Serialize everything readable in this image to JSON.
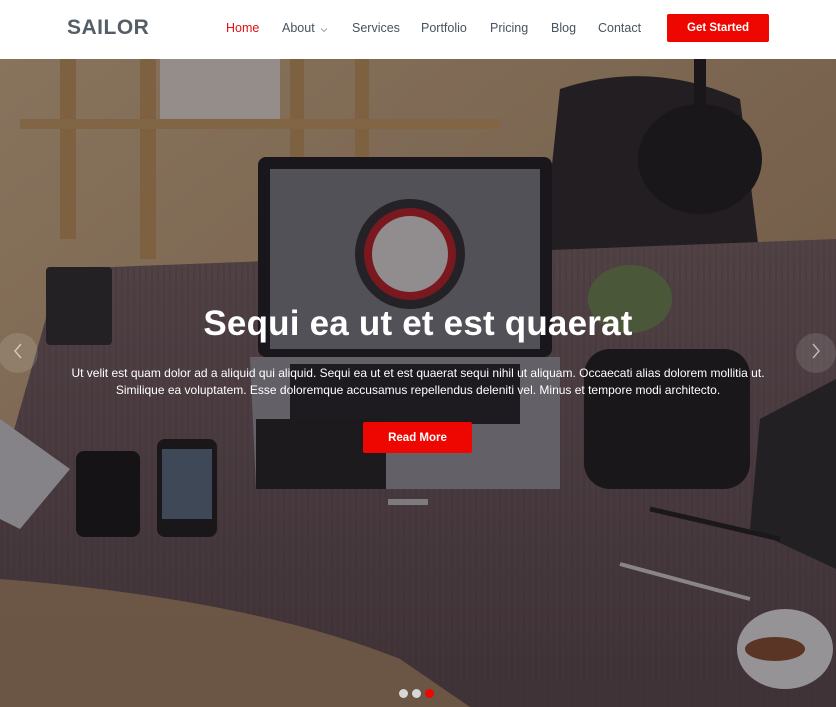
{
  "brand": {
    "logo": "SAILOR",
    "accent": "#ee0600",
    "nav_active_color": "#e3100e"
  },
  "nav": {
    "items": [
      {
        "label": "Home",
        "active": true
      },
      {
        "label": "About",
        "has_dropdown": true
      },
      {
        "label": "Services"
      },
      {
        "label": "Portfolio"
      },
      {
        "label": "Pricing"
      },
      {
        "label": "Blog"
      },
      {
        "label": "Contact"
      }
    ],
    "cta_label": "Get Started"
  },
  "hero": {
    "title": "Sequi ea ut et est quaerat",
    "text": "Ut velit est quam dolor ad a aliquid qui aliquid. Sequi ea ut et est quaerat sequi nihil ut aliquam. Occaecati alias dolorem mollitia ut. Similique ea voluptatem. Esse doloremque accusamus repellendus deleniti vel. Minus et tempore modi architecto.",
    "button_label": "Read More",
    "icons": {
      "prev": "chevron-left-icon",
      "next": "chevron-right-icon"
    },
    "slides_total": 3,
    "active_slide": 3
  }
}
